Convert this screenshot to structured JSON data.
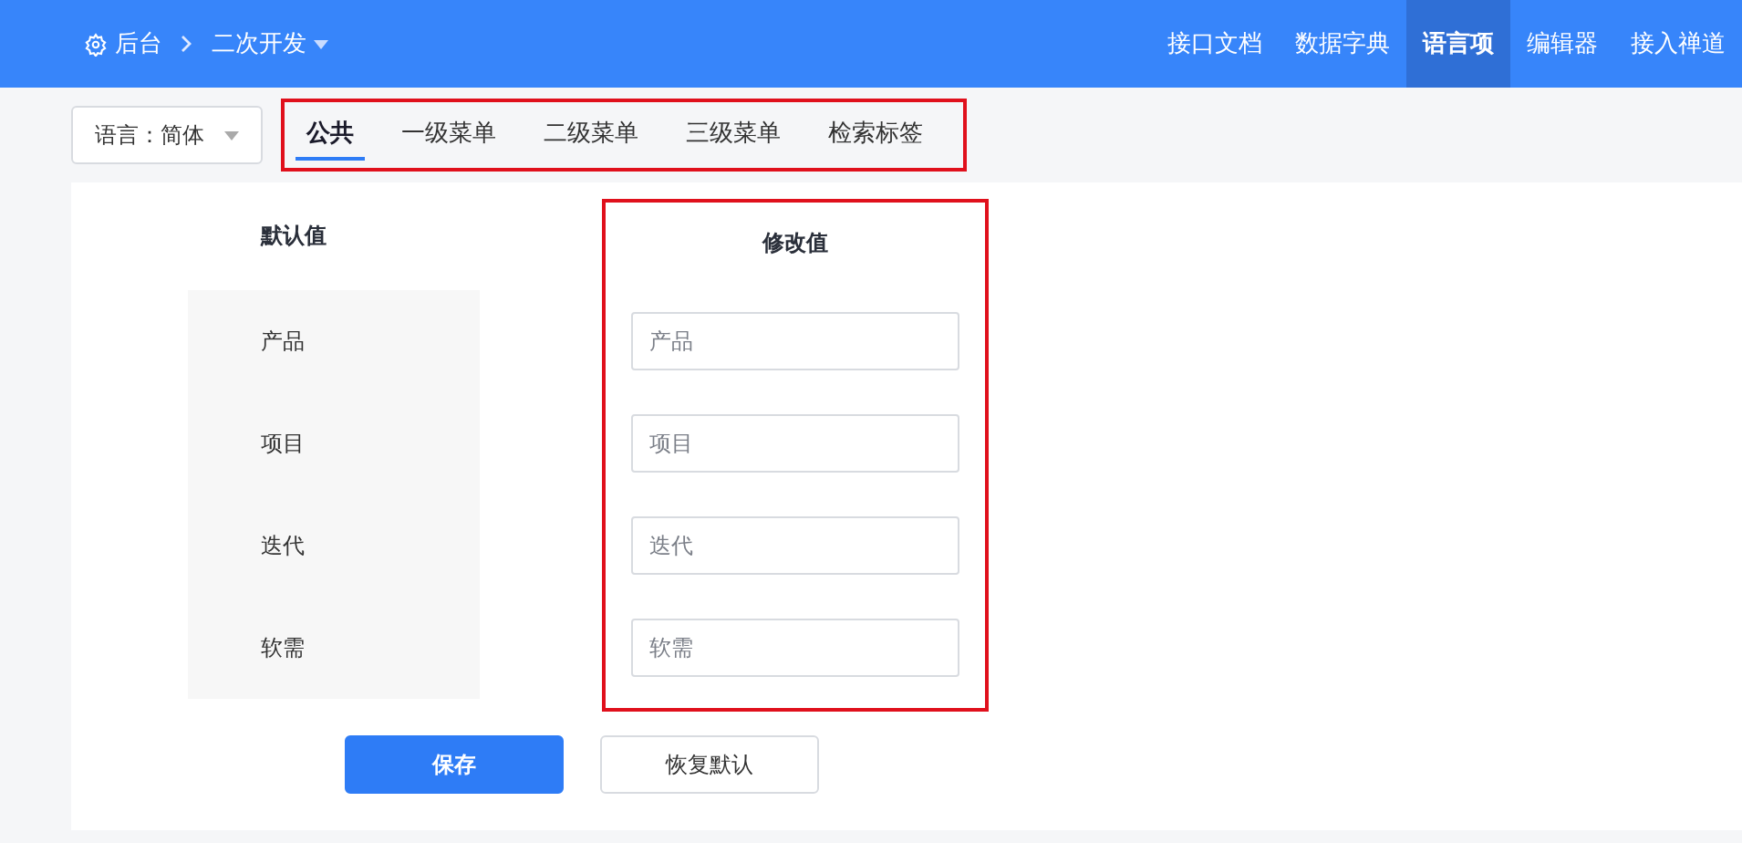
{
  "header": {
    "breadcrumb": [
      {
        "label": "后台",
        "kind": "home"
      },
      {
        "label": "二次开发",
        "kind": "dropdown"
      }
    ],
    "nav": [
      {
        "label": "接口文档",
        "selected": false
      },
      {
        "label": "数据字典",
        "selected": false
      },
      {
        "label": "语言项",
        "selected": true
      },
      {
        "label": "编辑器",
        "selected": false
      },
      {
        "label": "接入禅道",
        "selected": false
      }
    ]
  },
  "language_select": {
    "value": "语言：简体"
  },
  "tabs": [
    {
      "label": "公共",
      "selected": true
    },
    {
      "label": "一级菜单",
      "selected": false
    },
    {
      "label": "二级菜单",
      "selected": false
    },
    {
      "label": "三级菜单",
      "selected": false
    },
    {
      "label": "检索标签",
      "selected": false
    }
  ],
  "table": {
    "columns": [
      "默认值",
      "修改值"
    ],
    "rows": [
      {
        "default": "产品",
        "placeholder": "产品"
      },
      {
        "default": "项目",
        "placeholder": "项目"
      },
      {
        "default": "迭代",
        "placeholder": "迭代"
      },
      {
        "default": "软需",
        "placeholder": "软需"
      }
    ]
  },
  "buttons": [
    {
      "label": "保存",
      "kind": "primary"
    },
    {
      "label": "恢复默认",
      "kind": "secondary"
    }
  ]
}
